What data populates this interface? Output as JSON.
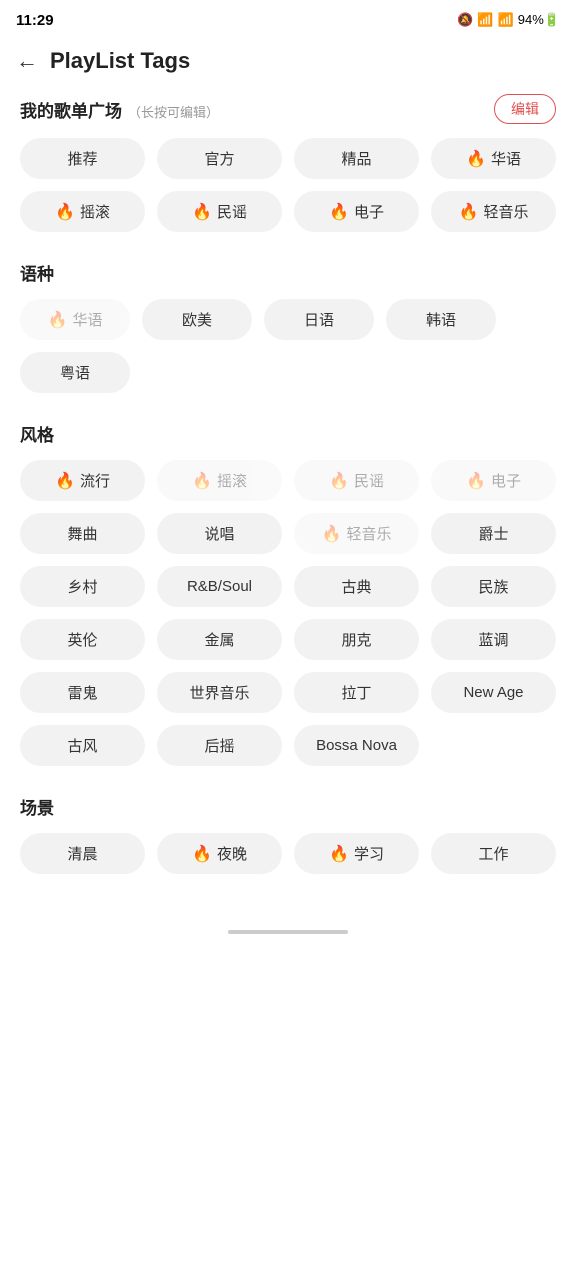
{
  "statusBar": {
    "time": "11:29",
    "icons": "🔕 📶 94%🔋"
  },
  "header": {
    "backLabel": "←",
    "title": "PlayList Tags"
  },
  "mySection": {
    "title": "我的歌单广场",
    "subtitle": "（长按可编辑）",
    "editLabel": "编辑",
    "tags": [
      {
        "label": "推荐",
        "fire": false,
        "dimmed": false
      },
      {
        "label": "官方",
        "fire": false,
        "dimmed": false
      },
      {
        "label": "精品",
        "fire": false,
        "dimmed": false
      },
      {
        "label": "华语",
        "fire": true,
        "dimmed": false
      },
      {
        "label": "摇滚",
        "fire": true,
        "dimmed": false
      },
      {
        "label": "民谣",
        "fire": true,
        "dimmed": false
      },
      {
        "label": "电子",
        "fire": true,
        "dimmed": false
      },
      {
        "label": "轻音乐",
        "fire": true,
        "dimmed": false
      }
    ]
  },
  "languageSection": {
    "title": "语种",
    "tags": [
      {
        "label": "华语",
        "fire": true,
        "dimmed": true
      },
      {
        "label": "欧美",
        "fire": false,
        "dimmed": false
      },
      {
        "label": "日语",
        "fire": false,
        "dimmed": false
      },
      {
        "label": "韩语",
        "fire": false,
        "dimmed": false
      },
      {
        "label": "粤语",
        "fire": false,
        "dimmed": false
      }
    ]
  },
  "styleSection": {
    "title": "风格",
    "tags": [
      {
        "label": "流行",
        "fire": true,
        "dimmed": false
      },
      {
        "label": "摇滚",
        "fire": true,
        "dimmed": true
      },
      {
        "label": "民谣",
        "fire": true,
        "dimmed": true
      },
      {
        "label": "电子",
        "fire": true,
        "dimmed": true
      },
      {
        "label": "舞曲",
        "fire": false,
        "dimmed": false
      },
      {
        "label": "说唱",
        "fire": false,
        "dimmed": false
      },
      {
        "label": "轻音乐",
        "fire": true,
        "dimmed": true
      },
      {
        "label": "爵士",
        "fire": false,
        "dimmed": false
      },
      {
        "label": "乡村",
        "fire": false,
        "dimmed": false
      },
      {
        "label": "R&B/Soul",
        "fire": false,
        "dimmed": false
      },
      {
        "label": "古典",
        "fire": false,
        "dimmed": false
      },
      {
        "label": "民族",
        "fire": false,
        "dimmed": false
      },
      {
        "label": "英伦",
        "fire": false,
        "dimmed": false
      },
      {
        "label": "金属",
        "fire": false,
        "dimmed": false
      },
      {
        "label": "朋克",
        "fire": false,
        "dimmed": false
      },
      {
        "label": "蓝调",
        "fire": false,
        "dimmed": false
      },
      {
        "label": "雷鬼",
        "fire": false,
        "dimmed": false
      },
      {
        "label": "世界音乐",
        "fire": false,
        "dimmed": false
      },
      {
        "label": "拉丁",
        "fire": false,
        "dimmed": false
      },
      {
        "label": "New Age",
        "fire": false,
        "dimmed": false
      },
      {
        "label": "古风",
        "fire": false,
        "dimmed": false
      },
      {
        "label": "后摇",
        "fire": false,
        "dimmed": false
      },
      {
        "label": "Bossa Nova",
        "fire": false,
        "dimmed": false
      }
    ]
  },
  "sceneSection": {
    "title": "场景",
    "tags": [
      {
        "label": "清晨",
        "fire": false,
        "dimmed": false
      },
      {
        "label": "夜晚",
        "fire": true,
        "dimmed": false
      },
      {
        "label": "学习",
        "fire": true,
        "dimmed": false
      },
      {
        "label": "工作",
        "fire": false,
        "dimmed": false
      }
    ]
  },
  "fireIcon": "🔥"
}
